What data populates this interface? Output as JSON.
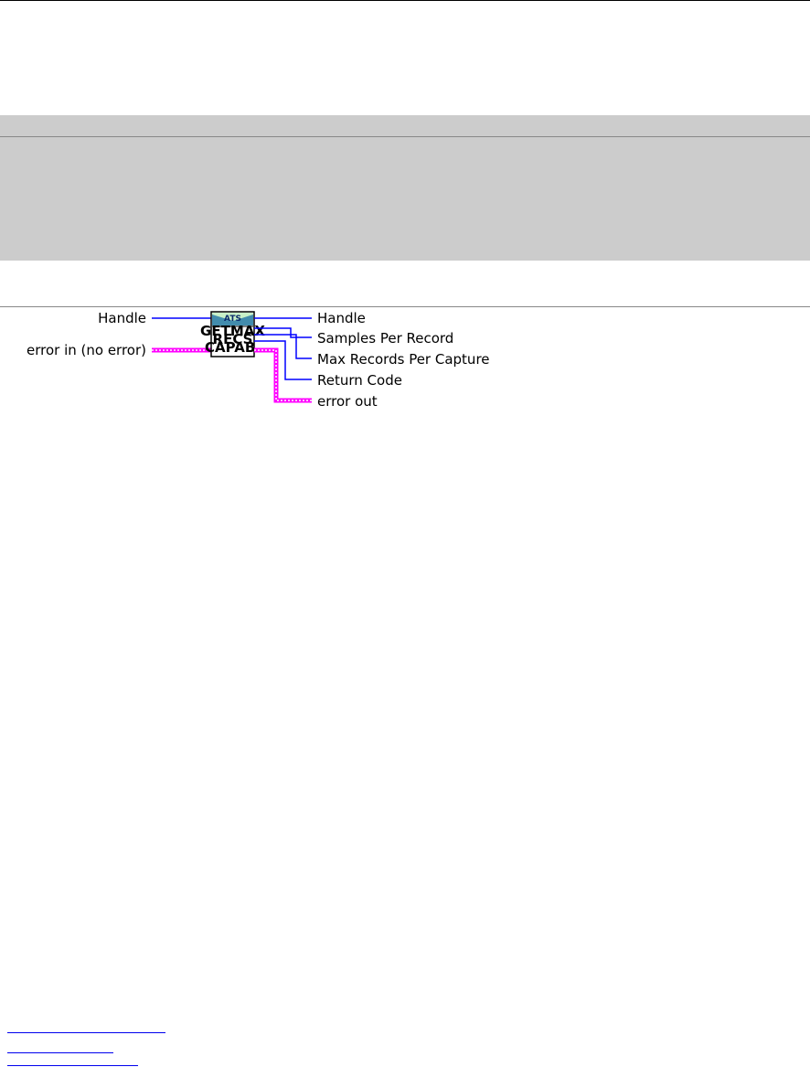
{
  "connector_pane": {
    "vi_icon": {
      "brand": "ATS",
      "lines": [
        "GETMAX",
        "RECS",
        "CAPAB."
      ],
      "header_color": "#c8f0c8"
    },
    "inputs": [
      {
        "label": "Handle",
        "wire": "reference"
      },
      {
        "label": "error in (no error)",
        "wire": "error-cluster"
      }
    ],
    "outputs": [
      {
        "label": "Handle",
        "wire": "reference"
      },
      {
        "label": "Samples Per Record",
        "wire": "numeric"
      },
      {
        "label": "Max Records Per Capture",
        "wire": "numeric"
      },
      {
        "label": "Return Code",
        "wire": "numeric"
      },
      {
        "label": "error out",
        "wire": "error-cluster"
      }
    ],
    "colors": {
      "numeric_wire": "#0000ff",
      "error_wire": "#ff00ff"
    }
  }
}
